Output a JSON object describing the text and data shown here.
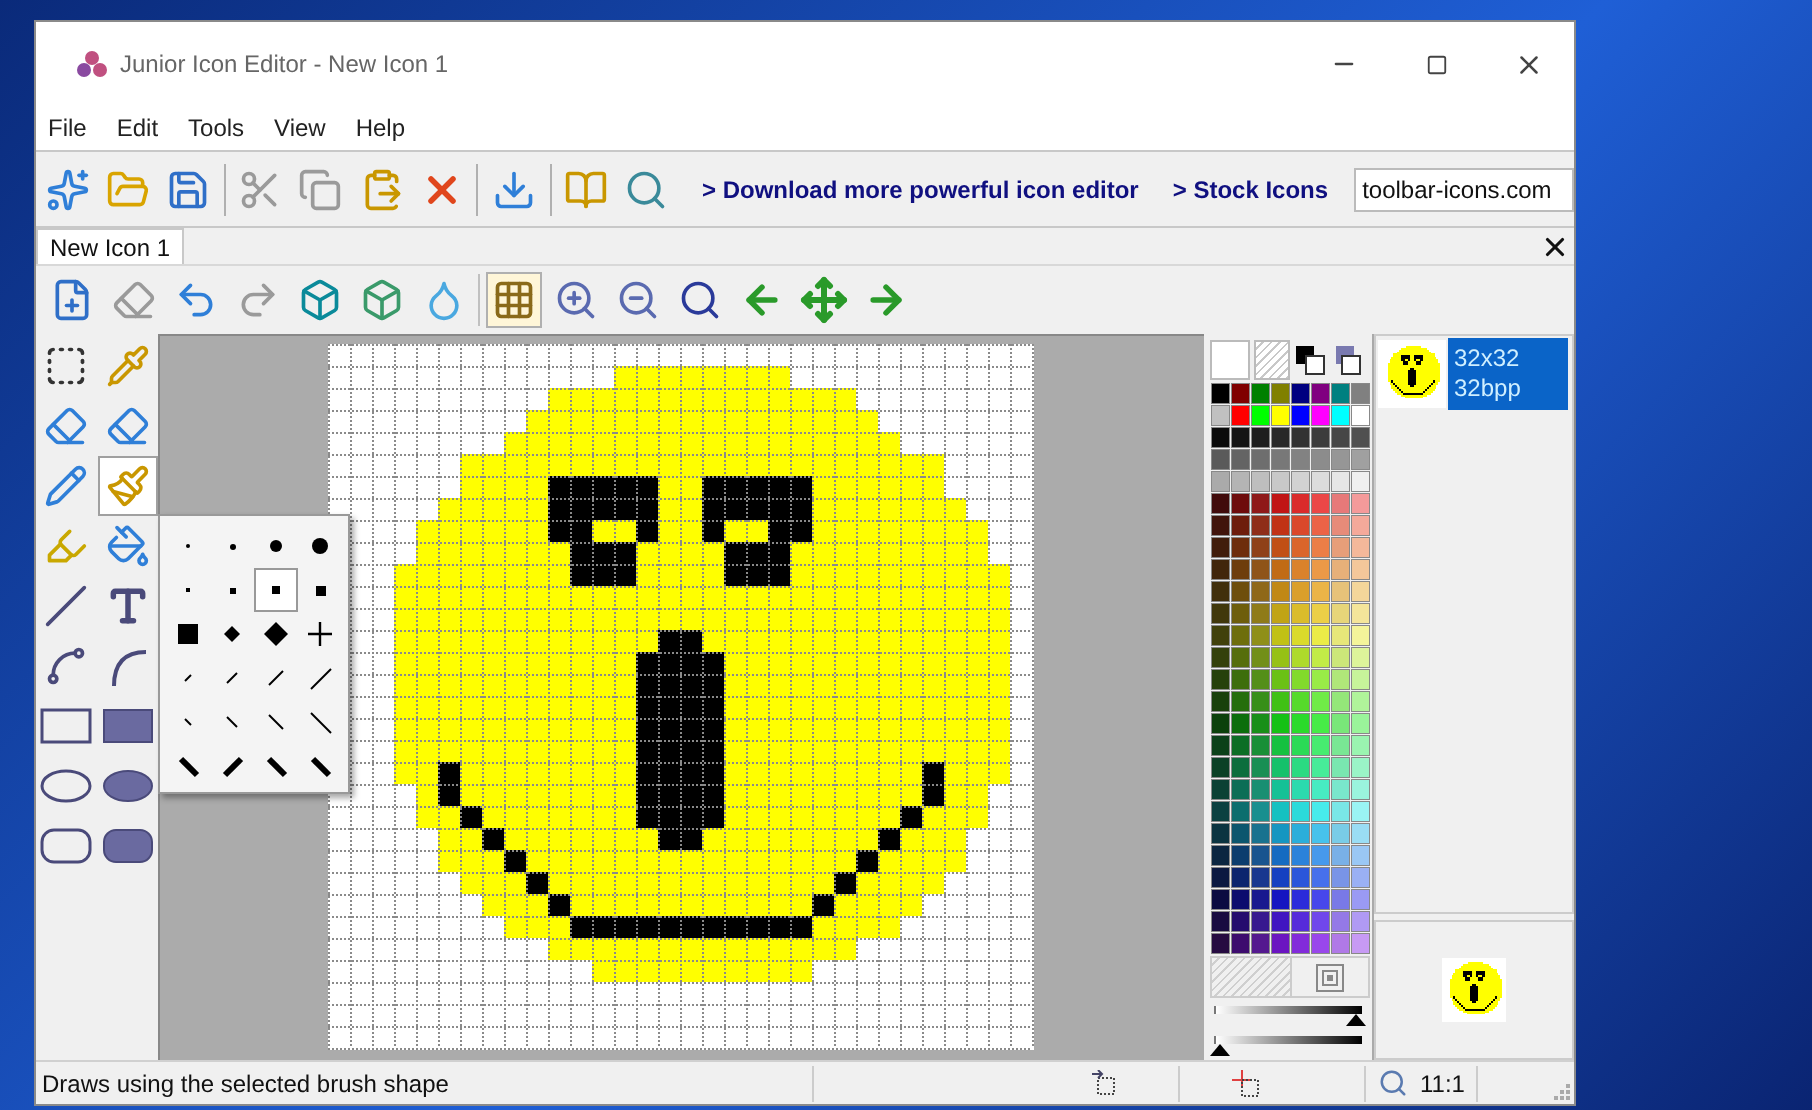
{
  "window": {
    "title": "Junior Icon Editor - New Icon 1"
  },
  "menu": [
    "File",
    "Edit",
    "Tools",
    "View",
    "Help"
  ],
  "main_toolbar": [
    {
      "disabled": false
    },
    {
      "disabled": false
    },
    {
      "disabled": false
    },
    {
      "disabled": true
    },
    {
      "disabled": true
    },
    {
      "disabled": false
    },
    {
      "disabled": false
    },
    {
      "disabled": false
    },
    {
      "disabled": false
    },
    {
      "disabled": false
    }
  ],
  "links": [
    "> Download more powerful icon editor",
    "> Stock Icons"
  ],
  "url_field": {
    "value": "toolbar-icons.com"
  },
  "tabs": [
    {
      "label": "New Icon 1",
      "selected": true
    }
  ],
  "edit_toolbar": [
    {
      "disabled": false,
      "pressed": false
    },
    {
      "disabled": true,
      "pressed": false
    },
    {
      "disabled": false,
      "pressed": false
    },
    {
      "disabled": true,
      "pressed": false
    },
    {
      "disabled": false,
      "pressed": false
    },
    {
      "disabled": false,
      "pressed": false
    },
    {
      "disabled": false,
      "pressed": false
    },
    {
      "disabled": false,
      "pressed": true
    },
    {
      "disabled": false,
      "pressed": false
    },
    {
      "disabled": false,
      "pressed": false
    },
    {
      "disabled": false,
      "pressed": false
    },
    {
      "disabled": false,
      "pressed": false
    },
    {
      "disabled": false,
      "pressed": false
    },
    {
      "disabled": false,
      "pressed": false
    }
  ],
  "tools": [
    {
      "selected": false
    },
    {
      "selected": false
    },
    {
      "selected": false
    },
    {
      "selected": false
    },
    {
      "selected": false
    },
    {
      "selected": true
    },
    {
      "selected": false
    },
    {
      "selected": false
    },
    {
      "selected": false
    },
    {
      "selected": false
    },
    {
      "selected": false
    },
    {
      "selected": false
    },
    {
      "selected": false
    },
    {
      "selected": false
    },
    {
      "selected": false
    },
    {
      "selected": false
    },
    {
      "selected": false
    },
    {
      "selected": false
    }
  ],
  "brush_shapes": [
    {
      "selected": false
    },
    {
      "selected": false
    },
    {
      "selected": false
    },
    {
      "selected": false
    },
    {
      "selected": false
    },
    {
      "selected": false
    },
    {
      "selected": true
    },
    {
      "selected": false
    },
    {
      "selected": false
    },
    {
      "selected": false
    },
    {
      "selected": false
    },
    {
      "selected": false
    },
    {
      "selected": false
    },
    {
      "selected": false
    },
    {
      "selected": false
    },
    {
      "selected": false
    },
    {
      "selected": false
    },
    {
      "selected": false
    },
    {
      "selected": false
    },
    {
      "selected": false
    },
    {
      "selected": false
    },
    {
      "selected": false
    },
    {
      "selected": false
    },
    {
      "selected": false
    }
  ],
  "sliders": [
    {
      "level": 1
    },
    {
      "level": 0
    }
  ],
  "icon_formats": [
    {
      "size": "32x32",
      "depth": "32bpp",
      "selected": true
    }
  ],
  "status_bar": {
    "text": "Draws using the selected brush shape",
    "zoom": "11:1"
  }
}
